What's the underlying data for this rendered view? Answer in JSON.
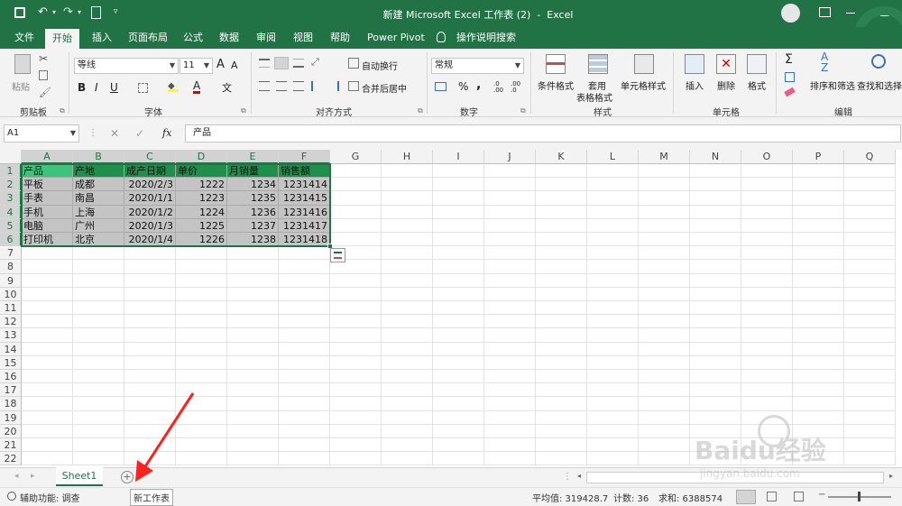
{
  "titlebar": {
    "title": "新建 Microsoft Excel 工作表 (2)  -  Excel",
    "colors": {
      "brand": "#217346"
    }
  },
  "tabs": [
    "文件",
    "开始",
    "插入",
    "页面布局",
    "公式",
    "数据",
    "审阅",
    "视图",
    "帮助",
    "Power Pivot"
  ],
  "tell_me": "操作说明搜索",
  "ribbon": {
    "clipboard": {
      "paste": "粘贴",
      "label": "剪贴板"
    },
    "font": {
      "name": "等线",
      "size": "11",
      "label": "字体",
      "bold": "B",
      "italic": "I",
      "underline": "U",
      "grow": "A",
      "shrink": "A",
      "phonetic": "文"
    },
    "alignment": {
      "wrap": "自动换行",
      "merge": "合并后居中",
      "label": "对齐方式"
    },
    "number": {
      "format": "常规",
      "label": "数字",
      "percent": "%",
      "comma": ","
    },
    "styles": {
      "conditional": "条件格式",
      "table1": "套用",
      "table2": "表格格式",
      "cell": "单元格样式",
      "label": "样式"
    },
    "cells": {
      "insert": "插入",
      "delete": "删除",
      "format": "格式",
      "label": "单元格"
    },
    "editing": {
      "sort": "排序和筛选",
      "find": "查找和选择",
      "label": "编辑"
    }
  },
  "formula_bar": {
    "name_box": "A1",
    "fx": "fx",
    "content": "产品"
  },
  "columns": [
    "A",
    "B",
    "C",
    "D",
    "E",
    "F",
    "G",
    "H",
    "I",
    "J",
    "K",
    "L",
    "M",
    "N",
    "O",
    "P",
    "Q"
  ],
  "rows": [
    "1",
    "2",
    "3",
    "4",
    "5",
    "6",
    "7",
    "8",
    "9",
    "10",
    "11",
    "12",
    "13",
    "14",
    "15",
    "16",
    "17",
    "18",
    "19",
    "20",
    "21",
    "22"
  ],
  "table": {
    "header": [
      "产品",
      "产地",
      "成产日期",
      "单价",
      "月销量",
      "销售额"
    ],
    "rows": [
      [
        "平板",
        "成都",
        "2020/2/3",
        "1222",
        "1234",
        "1231414"
      ],
      [
        "手表",
        "南昌",
        "2020/1/1",
        "1223",
        "1235",
        "1231415"
      ],
      [
        "手机",
        "上海",
        "2020/1/2",
        "1224",
        "1236",
        "1231416"
      ],
      [
        "电脑",
        "广州",
        "2020/1/3",
        "1225",
        "1237",
        "1231417"
      ],
      [
        "打印机",
        "北京",
        "2020/1/4",
        "1226",
        "1238",
        "1231418"
      ]
    ]
  },
  "sheets": {
    "active": "Sheet1",
    "tooltip": "新工作表"
  },
  "status": {
    "accessibility": "辅助功能: 调查",
    "average": "平均值: 319428.7",
    "count": "计数: 36",
    "sum": "求和: 6388574"
  },
  "watermark": {
    "brand": "Baidu经验",
    "url": "jingyan.baidu.com"
  }
}
